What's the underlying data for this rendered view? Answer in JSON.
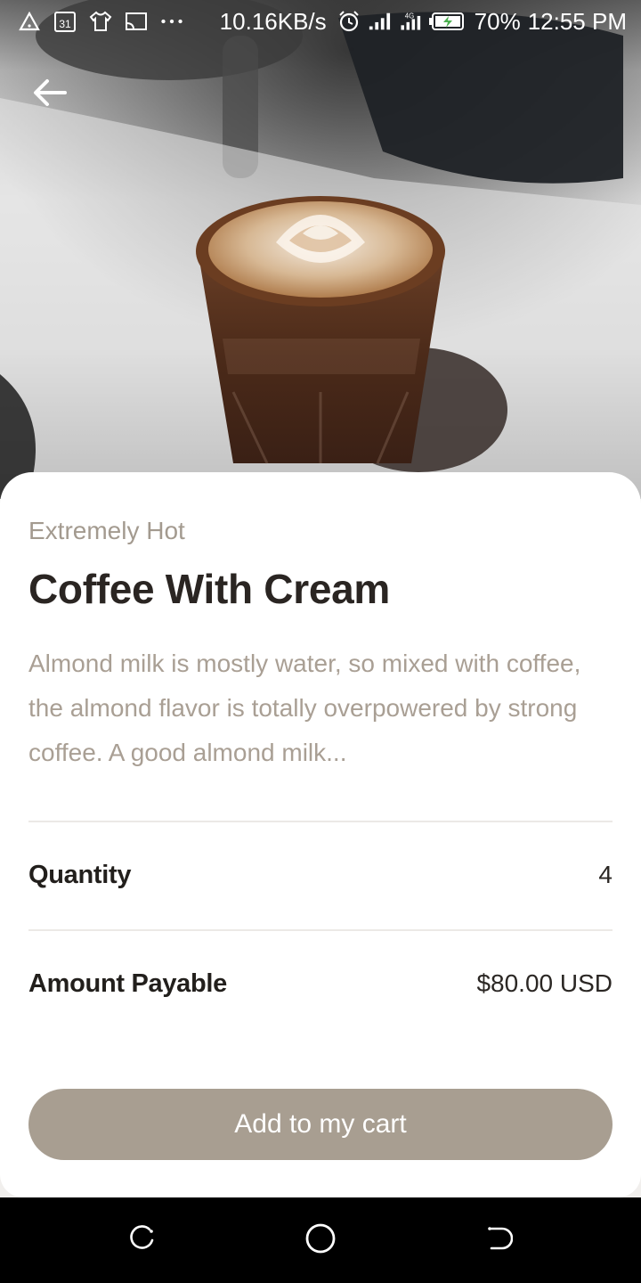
{
  "status_bar": {
    "network_speed": "10.16KB/s",
    "network_type": "4G",
    "battery": "70%",
    "time": "12:55 PM",
    "calendar_day": "31"
  },
  "product": {
    "subtitle": "Extremely Hot",
    "title": "Coffee With Cream",
    "description": "Almond milk is mostly water, so mixed with coffee, the almond flavor is totally overpowered by strong coffee. A good almond milk..."
  },
  "details": {
    "quantity_label": "Quantity",
    "quantity_value": "4",
    "amount_label": "Amount Payable",
    "amount_value": "$80.00 USD"
  },
  "actions": {
    "add_to_cart_label": "Add to my cart"
  },
  "icons": {
    "back": "arrow-left-icon",
    "nav_recents": "recents-icon",
    "nav_home": "home-icon",
    "nav_back": "back-nav-icon"
  },
  "colors": {
    "accent": "#a89e91",
    "subtitle": "#a39a8f",
    "title": "#2a2522",
    "nav_bar": "#000000"
  }
}
